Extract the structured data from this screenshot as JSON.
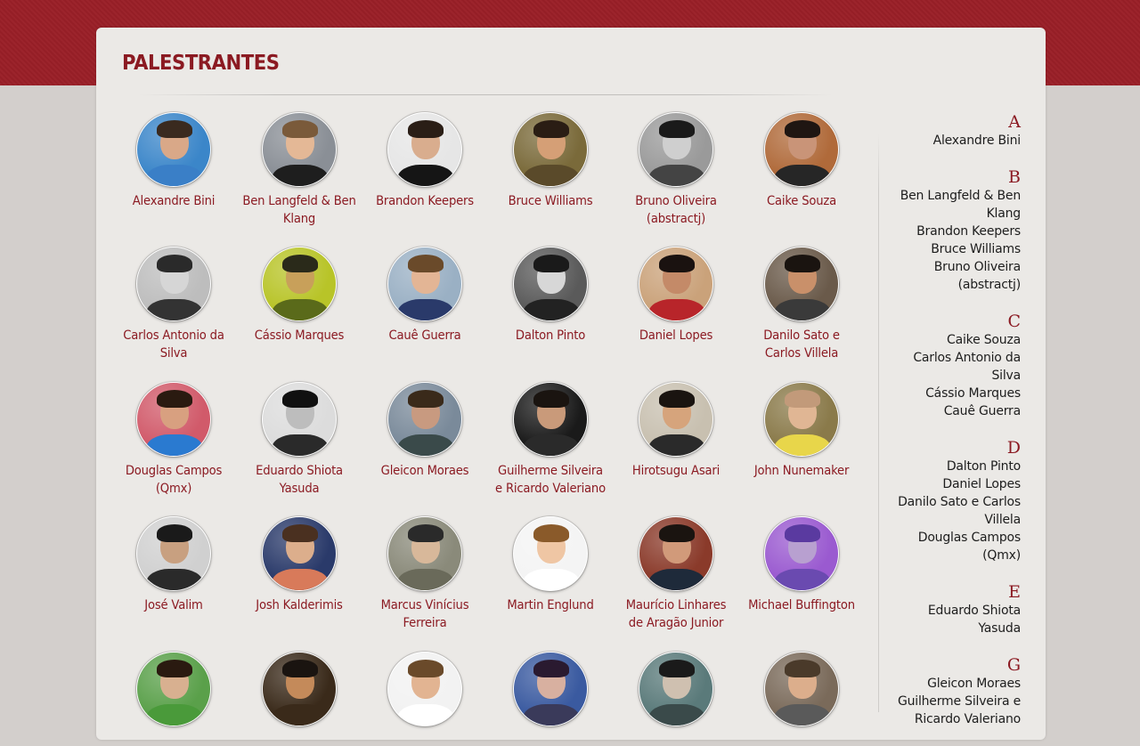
{
  "header": {
    "title": "PALESTRANTES"
  },
  "speakers": [
    {
      "name": "Alexandre Bini",
      "bg": "#3b86c9",
      "skin": "#d9a888",
      "hair": "#3a2a1f",
      "shirt": "#3a7fc7"
    },
    {
      "name": "Ben Langfeld & Ben Klang",
      "bg": "#8a8f96",
      "skin": "#e4b896",
      "hair": "#7a5a3a",
      "shirt": "#1e1e1e"
    },
    {
      "name": "Brandon Keepers",
      "bg": "#e6e6e6",
      "skin": "#d9ad8e",
      "hair": "#2a1e16",
      "shirt": "#151515"
    },
    {
      "name": "Bruce Williams",
      "bg": "#7a6a3a",
      "skin": "#d59f76",
      "hair": "#2a1d14",
      "shirt": "#5a4a2a"
    },
    {
      "name": "Bruno Oliveira (abstractj)",
      "bg": "#9a9a9a",
      "skin": "#cfcfcf",
      "hair": "#1a1a1a",
      "shirt": "#444444"
    },
    {
      "name": "Caike Souza",
      "bg": "#b06a3a",
      "skin": "#c99478",
      "hair": "#1f1612",
      "shirt": "#262626"
    },
    {
      "name": "Carlos Antonio da Silva",
      "bg": "#bdbdbd",
      "skin": "#d6d6d6",
      "hair": "#2a2a2a",
      "shirt": "#333333"
    },
    {
      "name": "Cássio Marques",
      "bg": "#b8c428",
      "skin": "#c8a05a",
      "hair": "#2a2a1a",
      "shirt": "#5a6a1a"
    },
    {
      "name": "Cauê Guerra",
      "bg": "#9ab0c4",
      "skin": "#e3b595",
      "hair": "#6a4a2a",
      "shirt": "#2a3a6a"
    },
    {
      "name": "Dalton Pinto",
      "bg": "#5a5a5a",
      "skin": "#d7d7d7",
      "hair": "#1a1a1a",
      "shirt": "#222222"
    },
    {
      "name": "Daniel Lopes",
      "bg": "#caa27a",
      "skin": "#c48a68",
      "hair": "#1a1210",
      "shirt": "#b8252a"
    },
    {
      "name": "Danilo Sato e Carlos Villela",
      "bg": "#6a5a4a",
      "skin": "#c9906a",
      "hair": "#1a1410",
      "shirt": "#3a3a3a"
    },
    {
      "name": "Douglas Campos (Qmx)",
      "bg": "#d15a6a",
      "skin": "#d8a080",
      "hair": "#2a1a10",
      "shirt": "#2a7ad0"
    },
    {
      "name": "Eduardo Shiota Yasuda",
      "bg": "#dcdcdc",
      "skin": "#bdbdbd",
      "hair": "#101010",
      "shirt": "#2a2a2a"
    },
    {
      "name": "Gleicon Moraes",
      "bg": "#7a8a9a",
      "skin": "#c89a80",
      "hair": "#3a2a1a",
      "shirt": "#3a4a4a"
    },
    {
      "name": "Guilherme Silveira e Ricardo Valeriano",
      "bg": "#1a1a1a",
      "skin": "#c99a7a",
      "hair": "#1a1410",
      "shirt": "#2a2a2a"
    },
    {
      "name": "Hirotsugu Asari",
      "bg": "#c8c0b0",
      "skin": "#d6a47c",
      "hair": "#1a1410",
      "shirt": "#2a2a2a"
    },
    {
      "name": "John Nunemaker",
      "bg": "#8a7a4a",
      "skin": "#e0b694",
      "hair": "#c29a7a",
      "shirt": "#e8d64a"
    },
    {
      "name": "José Valim",
      "bg": "#d0d0d0",
      "skin": "#c8a080",
      "hair": "#1a1a1a",
      "shirt": "#2a2a2a"
    },
    {
      "name": "Josh Kalderimis",
      "bg": "#2a3a6a",
      "skin": "#dcae8c",
      "hair": "#4a3020",
      "shirt": "#d87a5a"
    },
    {
      "name": "Marcus Vinícius Ferreira",
      "bg": "#8a8a7a",
      "skin": "#d8b89a",
      "hair": "#2a2a2a",
      "shirt": "#6a6a5a"
    },
    {
      "name": "Martin Englund",
      "bg": "#f4f4f4",
      "skin": "#efc6a4",
      "hair": "#8a5a2a",
      "shirt": "#ffffff"
    },
    {
      "name": "Maurício Linhares de Aragão Junior",
      "bg": "#8a3a2a",
      "skin": "#d19a7a",
      "hair": "#1a1410",
      "shirt": "#1e2a3a"
    },
    {
      "name": "Michael Buffington",
      "bg": "#9a5ad0",
      "skin": "#b8a0d0",
      "hair": "#5a3aa0",
      "shirt": "#6a4ab0"
    },
    {
      "name": "",
      "bg": "#5aa04a",
      "skin": "#d8b090",
      "hair": "#2a1a10",
      "shirt": "#4a9a3a"
    },
    {
      "name": "",
      "bg": "#3a2a1a",
      "skin": "#c48a5a",
      "hair": "#1a1410",
      "shirt": "#3a2a1a"
    },
    {
      "name": "",
      "bg": "#f2f2f2",
      "skin": "#e2b492",
      "hair": "#6a4a2a",
      "shirt": "#ffffff"
    },
    {
      "name": "",
      "bg": "#3a5aa0",
      "skin": "#d8b0a0",
      "hair": "#2a1a30",
      "shirt": "#3a3a5a"
    },
    {
      "name": "",
      "bg": "#5a7a7a",
      "skin": "#cfc0b0",
      "hair": "#1a1a1a",
      "shirt": "#3a4a4a"
    },
    {
      "name": "",
      "bg": "#7a6a5a",
      "skin": "#dcae8c",
      "hair": "#4a3a2a",
      "shirt": "#5a5a5a"
    }
  ],
  "index": [
    {
      "letter": "A",
      "names": [
        "Alexandre Bini"
      ]
    },
    {
      "letter": "B",
      "names": [
        "Ben Langfeld & Ben Klang",
        "Brandon Keepers",
        "Bruce Williams",
        "Bruno Oliveira (abstractj)"
      ]
    },
    {
      "letter": "C",
      "names": [
        "Caike Souza",
        "Carlos Antonio da Silva",
        "Cássio Marques",
        "Cauê Guerra"
      ]
    },
    {
      "letter": "D",
      "names": [
        "Dalton Pinto",
        "Daniel Lopes",
        "Danilo Sato e Carlos Villela",
        "Douglas Campos (Qmx)"
      ]
    },
    {
      "letter": "E",
      "names": [
        "Eduardo Shiota Yasuda"
      ]
    },
    {
      "letter": "G",
      "names": [
        "Gleicon Moraes",
        "Guilherme Silveira e Ricardo Valeriano"
      ]
    }
  ]
}
